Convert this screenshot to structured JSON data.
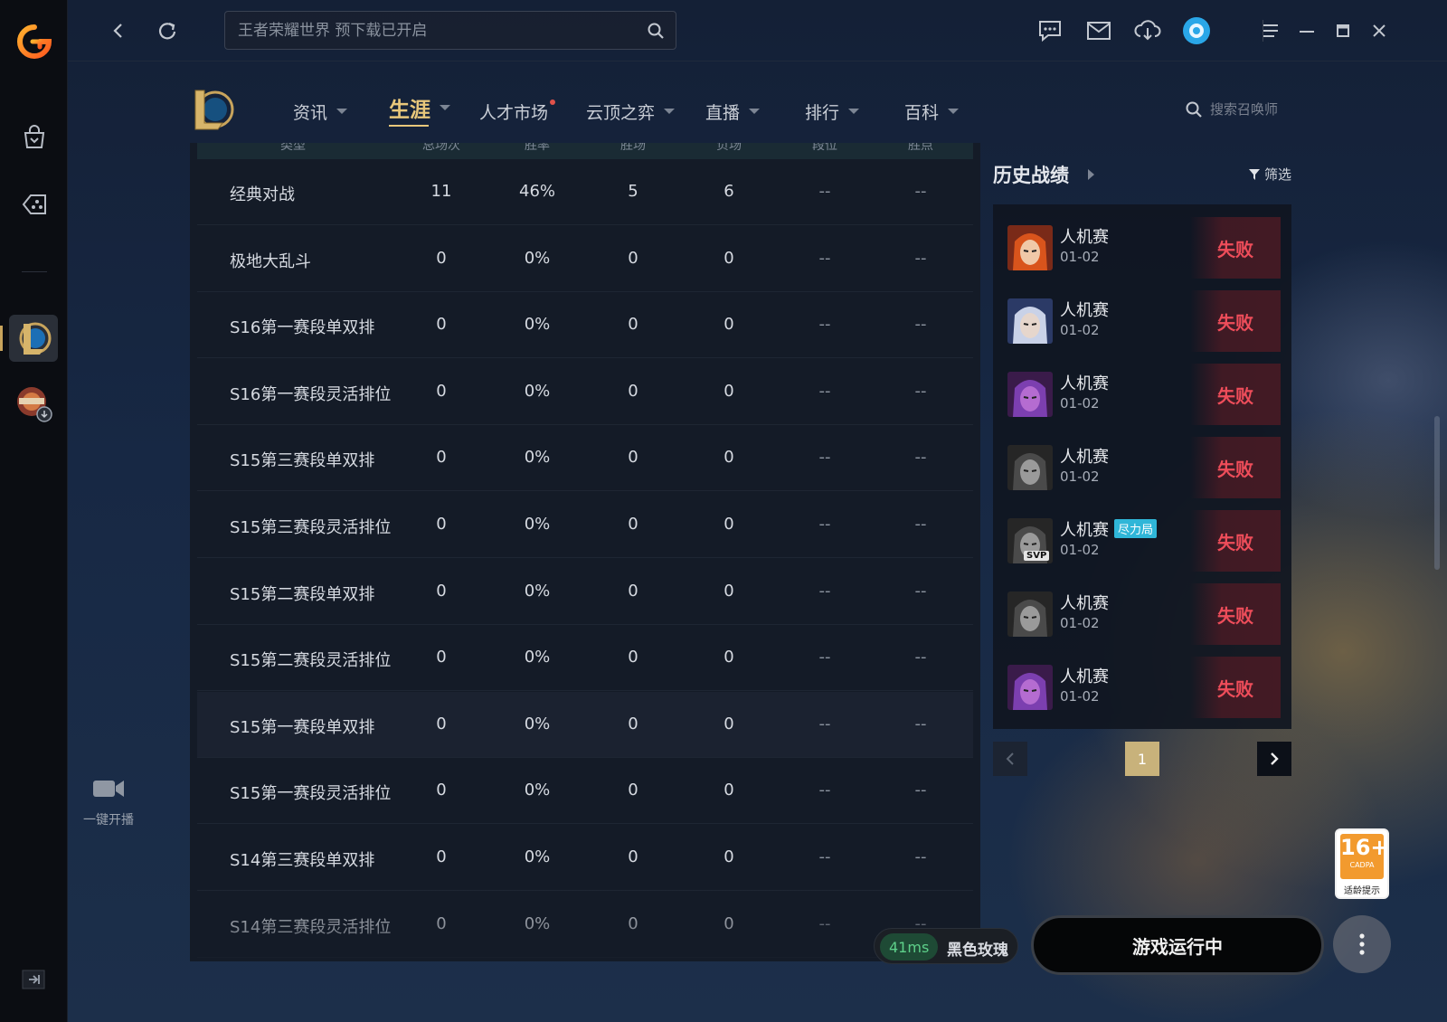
{
  "topbar": {
    "search_placeholder": "王者荣耀世界 预下载已开启"
  },
  "rail": {
    "live_label": "一键开播"
  },
  "nav": {
    "items": [
      {
        "label": "资讯"
      },
      {
        "label": "生涯"
      },
      {
        "label": "人才市场"
      },
      {
        "label": "云顶之弈"
      },
      {
        "label": "直播"
      },
      {
        "label": "排行"
      },
      {
        "label": "百科"
      }
    ],
    "active": "生涯",
    "search_placeholder": "搜索召唤师"
  },
  "table": {
    "headers": [
      "类型",
      "总场次",
      "胜率",
      "胜场",
      "负场",
      "段位",
      "胜点"
    ],
    "rows": [
      [
        "经典对战",
        "11",
        "46%",
        "5",
        "6",
        "--",
        "--"
      ],
      [
        "极地大乱斗",
        "0",
        "0%",
        "0",
        "0",
        "--",
        "--"
      ],
      [
        "S16第一赛段单双排",
        "0",
        "0%",
        "0",
        "0",
        "--",
        "--"
      ],
      [
        "S16第一赛段灵活排位",
        "0",
        "0%",
        "0",
        "0",
        "--",
        "--"
      ],
      [
        "S15第三赛段单双排",
        "0",
        "0%",
        "0",
        "0",
        "--",
        "--"
      ],
      [
        "S15第三赛段灵活排位",
        "0",
        "0%",
        "0",
        "0",
        "--",
        "--"
      ],
      [
        "S15第二赛段单双排",
        "0",
        "0%",
        "0",
        "0",
        "--",
        "--"
      ],
      [
        "S15第二赛段灵活排位",
        "0",
        "0%",
        "0",
        "0",
        "--",
        "--"
      ],
      [
        "S15第一赛段单双排",
        "0",
        "0%",
        "0",
        "0",
        "--",
        "--"
      ],
      [
        "S15第一赛段灵活排位",
        "0",
        "0%",
        "0",
        "0",
        "--",
        "--"
      ],
      [
        "S14第三赛段单双排",
        "0",
        "0%",
        "0",
        "0",
        "--",
        "--"
      ],
      [
        "S14第三赛段灵活排位",
        "0",
        "0%",
        "0",
        "0",
        "--",
        "--"
      ]
    ]
  },
  "history": {
    "title": "历史战绩",
    "filter_label": "筛选",
    "matches": [
      {
        "mode": "人机赛",
        "date": "01-02",
        "result": "失败",
        "tag": ""
      },
      {
        "mode": "人机赛",
        "date": "01-02",
        "result": "失败",
        "tag": ""
      },
      {
        "mode": "人机赛",
        "date": "01-02",
        "result": "失败",
        "tag": ""
      },
      {
        "mode": "人机赛",
        "date": "01-02",
        "result": "失败",
        "tag": ""
      },
      {
        "mode": "人机赛",
        "date": "01-02",
        "result": "失败",
        "tag": "尽力局"
      },
      {
        "mode": "人机赛",
        "date": "01-02",
        "result": "失败",
        "tag": ""
      },
      {
        "mode": "人机赛",
        "date": "01-02",
        "result": "失败",
        "tag": ""
      }
    ],
    "svp_label": "SVP",
    "page": "1"
  },
  "status": {
    "ping": "41ms",
    "server": "黑色玫瑰",
    "run_label": "游戏运行中",
    "age_rating": "16+",
    "age_org": "CADPA",
    "age_tip": "适龄提示"
  },
  "colors": {
    "accent_gold": "#e8c77b",
    "loss_red": "#ee4d5a",
    "ping_green": "#5ed08a",
    "tag_cyan": "#2fb6d8"
  }
}
